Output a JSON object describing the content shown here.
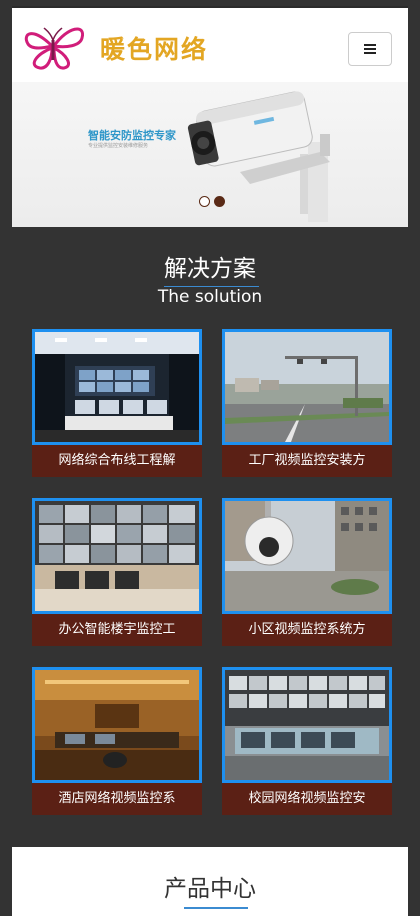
{
  "header": {
    "logo_text": "暖色网络",
    "menu_icon": "hamburger-menu-icon"
  },
  "banner": {
    "title": "智能安防监控专家",
    "subtitle": "专业提供监控安装维修服务",
    "slides": 2,
    "active_slide": 2
  },
  "solution": {
    "title": "解决方案",
    "subtitle": "The solution",
    "items": [
      {
        "label": "网络综合布线工程解"
      },
      {
        "label": "工厂视频监控安装方"
      },
      {
        "label": "办公智能楼宇监控工"
      },
      {
        "label": "小区视频监控系统方"
      },
      {
        "label": "酒店网络视频监控系"
      },
      {
        "label": "校园网络视频监控安"
      }
    ]
  },
  "products": {
    "title": "产品中心"
  },
  "colors": {
    "accent_blue": "#1e90f0",
    "caption_bg": "#5b2015",
    "logo_gold": "#e3a623",
    "page_bg": "#333333"
  }
}
